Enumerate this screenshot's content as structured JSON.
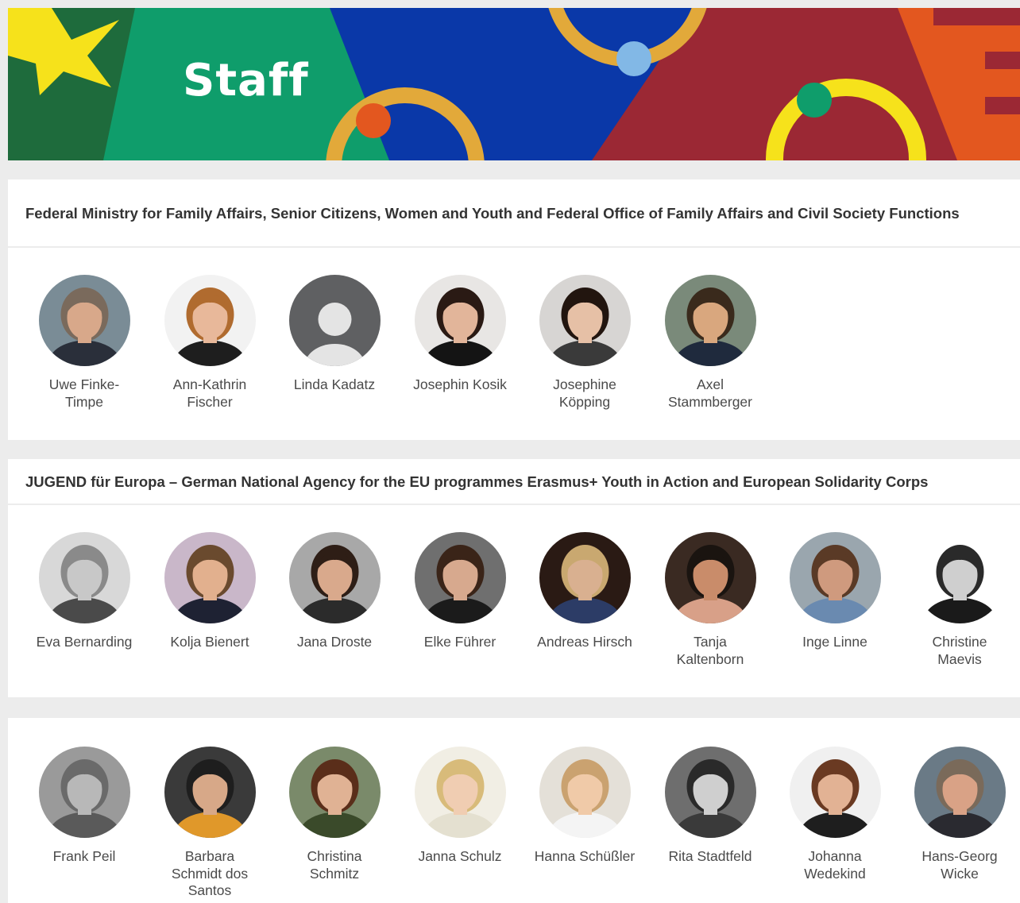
{
  "banner": {
    "title": "Staff",
    "colors": {
      "dark_green": "#1e6b3c",
      "green": "#0f9d6b",
      "blue": "#0a38a8",
      "burgundy": "#9b2834",
      "orange": "#e3571f",
      "yellow": "#f6e21b",
      "gold": "#e2a93a",
      "light_blue": "#82b8e6"
    }
  },
  "sections": [
    {
      "title": "Federal Ministry for Family Affairs, Senior Citizens, Women and Youth and Federal Office of Family Affairs and Civil Society Functions",
      "people": [
        {
          "name": "Uwe Finke-Timpe",
          "bg": "#7a8c96",
          "skin": "#d8a88a",
          "hair": "#7a6a5c",
          "cloth": "#2a2f3a"
        },
        {
          "name": "Ann-Kathrin Fischer",
          "bg": "#f2f2f2",
          "skin": "#e8b89a",
          "hair": "#b06b2f",
          "cloth": "#1e1e1e"
        },
        {
          "name": "Linda Kadatz",
          "placeholder": true
        },
        {
          "name": "Josephin Kosik",
          "bg": "#e8e6e4",
          "skin": "#e2b59a",
          "hair": "#2a1a14",
          "cloth": "#141414"
        },
        {
          "name": "Josephine Köpping",
          "bg": "#d7d5d3",
          "skin": "#e6c0a6",
          "hair": "#22150f",
          "cloth": "#3a3a3a"
        },
        {
          "name": "Axel Stammberger",
          "bg": "#7a8a7a",
          "skin": "#d9a77e",
          "hair": "#3a2a1c",
          "cloth": "#1f2a3d"
        }
      ]
    },
    {
      "title": "JUGEND für Europa – German National Agency for the EU programmes Erasmus+ Youth in Action and European Solidarity Corps",
      "people": [
        {
          "name": "Eva Bernarding",
          "bg": "#d8d8d8",
          "skin": "#c8c8c8",
          "hair": "#8a8a8a",
          "cloth": "#4a4a4a"
        },
        {
          "name": "Kolja Bienert",
          "bg": "#c9b7c9",
          "skin": "#e2b08e",
          "hair": "#6a4a2e",
          "cloth": "#1e2233"
        },
        {
          "name": "Jana Droste",
          "bg": "#a8a8a8",
          "skin": "#d9a98c",
          "hair": "#2e1e16",
          "cloth": "#2b2b2b"
        },
        {
          "name": "Elke Führer",
          "bg": "#6f6f6f",
          "skin": "#d7a98e",
          "hair": "#3a2418",
          "cloth": "#1b1b1b"
        },
        {
          "name": "Andreas Hirsch",
          "bg": "#2a1a14",
          "skin": "#d9b090",
          "hair": "#c9a870",
          "cloth": "#2c3c66"
        },
        {
          "name": "Tanja Kaltenborn",
          "bg": "#3a2a22",
          "skin": "#c98c6a",
          "hair": "#1a1410",
          "cloth": "#d8a088"
        },
        {
          "name": "Inge Linne",
          "bg": "#9aa6ae",
          "skin": "#cf9a7e",
          "hair": "#5a3a26",
          "cloth": "#6a8ab0"
        },
        {
          "name": "Christine Maevis",
          "bg": "#ffffff",
          "skin": "#cfcfcf",
          "hair": "#2a2a2a",
          "cloth": "#1a1a1a"
        }
      ]
    },
    {
      "title": "",
      "people": [
        {
          "name": "Frank Peil",
          "bg": "#9a9a9a",
          "skin": "#b8b8b8",
          "hair": "#6a6a6a",
          "cloth": "#5a5a5a"
        },
        {
          "name": "Barbara Schmidt dos Santos",
          "bg": "#3a3a3a",
          "skin": "#d7a888",
          "hair": "#1e1e1e",
          "cloth": "#e0982a"
        },
        {
          "name": "Christina Schmitz",
          "bg": "#7a8a6a",
          "skin": "#e0b294",
          "hair": "#5a2e1a",
          "cloth": "#3a4a2a"
        },
        {
          "name": "Janna Schulz",
          "bg": "#f1eee4",
          "skin": "#f0cdb2",
          "hair": "#d8bb7a",
          "cloth": "#e4e0d0"
        },
        {
          "name": "Hanna Schüßler",
          "bg": "#e4e0d8",
          "skin": "#f0caa8",
          "hair": "#caa270",
          "cloth": "#f4f4f4"
        },
        {
          "name": "Rita Stadtfeld",
          "bg": "#6e6e6e",
          "skin": "#cfcfcf",
          "hair": "#2a2a2a",
          "cloth": "#3a3a3a"
        },
        {
          "name": "Johanna Wedekind",
          "bg": "#f0f0f0",
          "skin": "#e2b294",
          "hair": "#6a3a22",
          "cloth": "#1e1e1e"
        },
        {
          "name": "Hans-Georg Wicke",
          "bg": "#6a7a86",
          "skin": "#d9a286",
          "hair": "#7a6a5a",
          "cloth": "#2a2a30"
        }
      ]
    }
  ]
}
